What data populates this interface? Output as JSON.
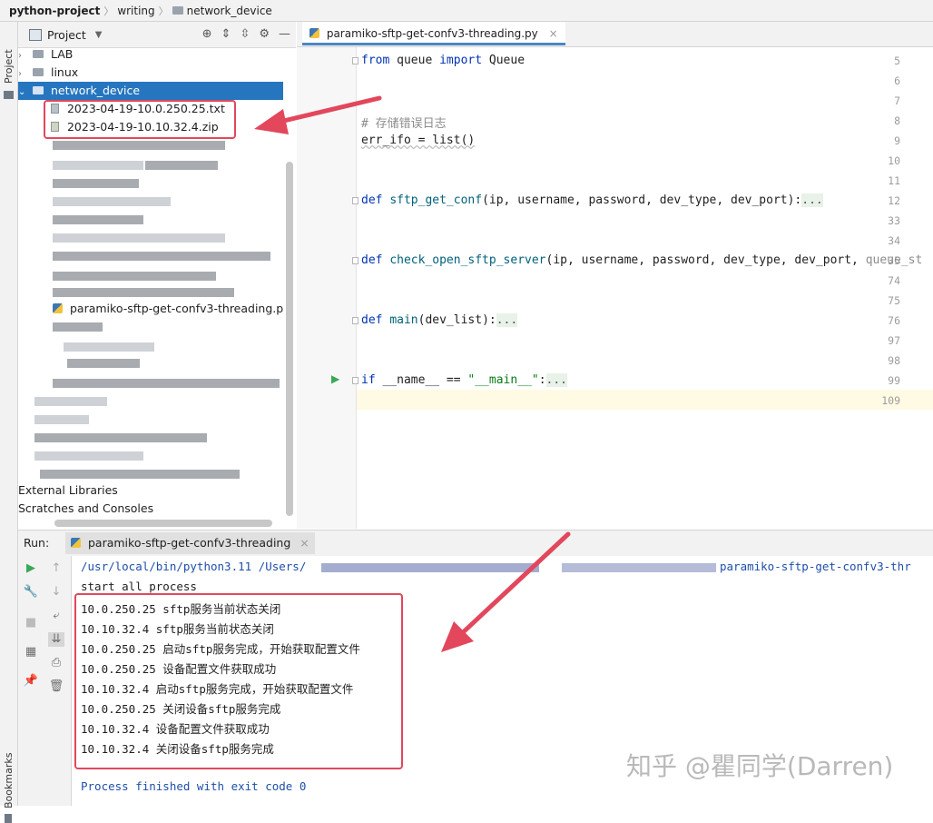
{
  "breadcrumb": {
    "project": "python-project",
    "folder1": "writing",
    "folder2": "network_device"
  },
  "project_panel": {
    "title": "Project",
    "tree": {
      "lab": "LAB",
      "linux": "linux",
      "network_device": "network_device",
      "file_txt": "2023-04-19-10.0.250.25.txt",
      "file_zip": "2023-04-19-10.10.32.4.zip",
      "py_file": "paramiko-sftp-get-confv3-threading.p",
      "external": "External Libraries",
      "scratches": "Scratches and Consoles"
    }
  },
  "editor": {
    "tab_label": "paramiko-sftp-get-confv3-threading.py",
    "lines": [
      {
        "n": "5"
      },
      {
        "n": "6"
      },
      {
        "n": "7"
      },
      {
        "n": "8"
      },
      {
        "n": "9"
      },
      {
        "n": "10"
      },
      {
        "n": "11"
      },
      {
        "n": "12"
      },
      {
        "n": "33"
      },
      {
        "n": "34"
      },
      {
        "n": "35"
      },
      {
        "n": "74"
      },
      {
        "n": "75"
      },
      {
        "n": "76"
      },
      {
        "n": "97"
      },
      {
        "n": "98"
      },
      {
        "n": "99"
      },
      {
        "n": "109"
      }
    ],
    "code": {
      "l5_kw1": "from",
      "l5_mod": " queue ",
      "l5_kw2": "import",
      "l5_name": " Queue",
      "l8": "# 存储错误日志",
      "l9": "err_ifo = list()",
      "l12_kw": "def",
      "l12_fn": "sftp_get_conf",
      "l12_args": "(ip, username, password, dev_type, dev_port):",
      "l12_fold": "...",
      "l35_kw": "def",
      "l35_fn": "check_open_sftp_server",
      "l35_args": "(ip, username, password, dev_type, dev_port, ",
      "l35_dim": "queue_st",
      "l76_kw": "def",
      "l76_fn": "main",
      "l76_args": "(dev_list):",
      "l76_fold": "...",
      "l99_kw": "if",
      "l99_a": " __name__ == ",
      "l99_str": "\"__main__\"",
      "l99_b": ":",
      "l99_fold": "..."
    }
  },
  "run_panel": {
    "label": "Run:",
    "tab": "paramiko-sftp-get-confv3-threading",
    "console": {
      "path_start": "/usr/local/bin/python3.11 /Users/",
      "path_end": "paramiko-sftp-get-confv3-thr",
      "start": "start all process",
      "lines": [
        "10.0.250.25 sftp服务当前状态关闭",
        "10.10.32.4 sftp服务当前状态关闭",
        "10.0.250.25 启动sftp服务完成，开始获取配置文件",
        "10.0.250.25 设备配置文件获取成功",
        "10.10.32.4 启动sftp服务完成，开始获取配置文件",
        "10.0.250.25 关闭设备sftp服务完成",
        "10.10.32.4 设备配置文件获取成功",
        "10.10.32.4 关闭设备sftp服务完成"
      ],
      "finished": "Process finished with exit code 0"
    }
  },
  "side_tabs": {
    "project": "Project",
    "bookmarks": "Bookmarks"
  },
  "watermark": "知乎 @瞿同学(Darren)",
  "colors": {
    "selection": "#2675bf",
    "annotation": "#e2475c",
    "keyword": "#0033b3"
  }
}
